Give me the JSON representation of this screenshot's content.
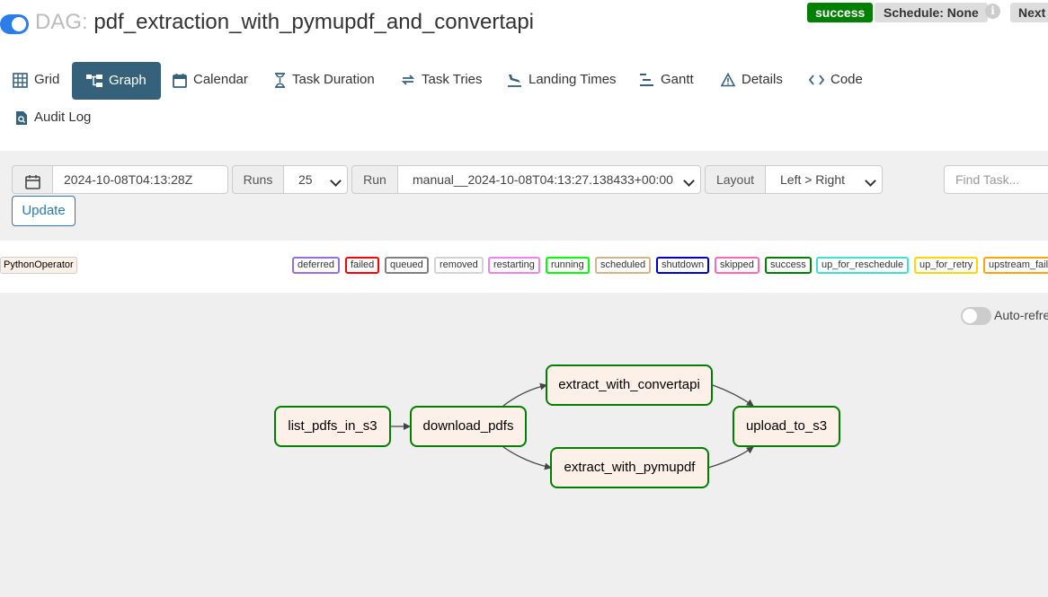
{
  "header": {
    "dag_prefix": "DAG:",
    "dag_id": "pdf_extraction_with_pymupdf_and_convertapi",
    "status": "success",
    "schedule": "Schedule: None",
    "info_icon": "info-icon",
    "next_label": "Next"
  },
  "tabs": [
    {
      "label": "Grid",
      "icon": "grid-icon"
    },
    {
      "label": "Graph",
      "icon": "graph-icon"
    },
    {
      "label": "Calendar",
      "icon": "calendar-icon"
    },
    {
      "label": "Task Duration",
      "icon": "hourglass-icon"
    },
    {
      "label": "Task Tries",
      "icon": "retry-icon"
    },
    {
      "label": "Landing Times",
      "icon": "landing-icon"
    },
    {
      "label": "Gantt",
      "icon": "gantt-icon"
    },
    {
      "label": "Details",
      "icon": "warning-triangle-icon"
    },
    {
      "label": "Code",
      "icon": "code-icon"
    },
    {
      "label": "Audit Log",
      "icon": "audit-log-icon"
    }
  ],
  "controls": {
    "date_value": "2024-10-08T04:13:28Z",
    "runs_label": "Runs",
    "runs_value": "25",
    "run_label": "Run",
    "run_value": "manual__2024-10-08T04:13:27.138433+00:00",
    "layout_label": "Layout",
    "layout_value": "Left > Right",
    "find_placeholder": "Find Task...",
    "update_label": "Update"
  },
  "legend": {
    "operator": "PythonOperator",
    "states": [
      {
        "label": "deferred",
        "color": "#9370db"
      },
      {
        "label": "failed",
        "color": "#ff0000"
      },
      {
        "label": "queued",
        "color": "#808080"
      },
      {
        "label": "removed",
        "color": "#d3d3d3"
      },
      {
        "label": "restarting",
        "color": "#ee82ee"
      },
      {
        "label": "running",
        "color": "#00ff00"
      },
      {
        "label": "scheduled",
        "color": "#d2b48c"
      },
      {
        "label": "shutdown",
        "color": "#0000cd"
      },
      {
        "label": "skipped",
        "color": "#ff69b4"
      },
      {
        "label": "success",
        "color": "#008000"
      },
      {
        "label": "up_for_reschedule",
        "color": "#40e0d0"
      },
      {
        "label": "up_for_retry",
        "color": "#ffd700"
      },
      {
        "label": "upstream_failed",
        "color": "#ffa500"
      }
    ]
  },
  "graph": {
    "auto_refresh_label": "Auto-refresh",
    "nodes": [
      {
        "id": "list_pdfs_in_s3",
        "state": "success"
      },
      {
        "id": "download_pdfs",
        "state": "success"
      },
      {
        "id": "extract_with_convertapi",
        "state": "success"
      },
      {
        "id": "extract_with_pymupdf",
        "state": "success"
      },
      {
        "id": "upload_to_s3",
        "state": "success"
      }
    ]
  }
}
